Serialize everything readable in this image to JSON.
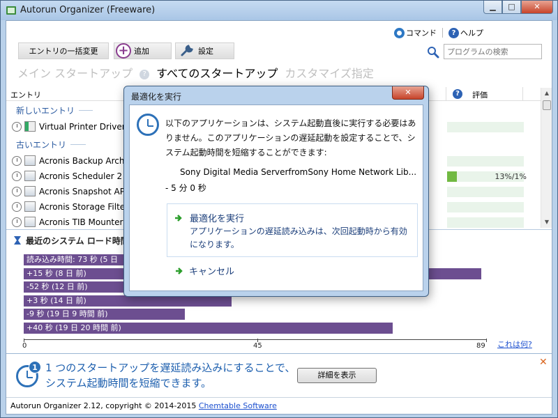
{
  "window": {
    "title": "Autorun Organizer (Freeware)",
    "minimize_glyph": "▁",
    "maximize_glyph": "□",
    "close_glyph": "✕"
  },
  "toolbar": {
    "command_label": "コマンド",
    "help_label": "ヘルプ",
    "bulk_edit_label": "エントリの一括変更",
    "add_label": "追加",
    "settings_label": "設定",
    "search_placeholder": "プログラムの検索"
  },
  "tabs": {
    "main": "メイン スタートアップ",
    "help_glyph": "?",
    "all": "すべてのスタートアップ",
    "custom": "カスタマイズ指定"
  },
  "list": {
    "header_entry": "エントリ",
    "header_question": "?",
    "header_rating": "評価",
    "group_new": "新しいエントリ",
    "group_old": "古いエントリ",
    "new_entries": [
      {
        "name": "Virtual Printer Driver cc",
        "percent": 0,
        "label": ""
      }
    ],
    "old_entries": [
      {
        "name": "Acronis Backup Archive",
        "percent": 0,
        "label": ""
      },
      {
        "name": "Acronis Scheduler 2",
        "percent": 13,
        "label": "13%/1%"
      },
      {
        "name": "Acronis Snapshot APIb",
        "percent": 0,
        "label": ""
      },
      {
        "name": "Acronis Storage Filter M",
        "percent": 0,
        "label": ""
      },
      {
        "name": "Acronis TIB Mounter D",
        "percent": 0,
        "label": ""
      }
    ]
  },
  "boot": {
    "title": "最近のシステム ロード時間",
    "axis_max": 89,
    "bars": [
      {
        "label": "読み込み時間: 73 秒 (5 日",
        "value": 73
      },
      {
        "label": "+15 秒 (8 日 前)",
        "value": 88
      },
      {
        "label": "-52 秒 (12 日 前)",
        "value": 21
      },
      {
        "label": "+3 秒 (14 日 前)",
        "value": 40
      },
      {
        "label": "-9 秒 (19 日 9 時間 前)",
        "value": 31
      },
      {
        "label": "+40 秒 (19 日 20 時間 前)",
        "value": 71
      }
    ],
    "ticks": [
      "0",
      "45",
      "89"
    ],
    "what_link": "これは何?"
  },
  "info": {
    "badge": "1",
    "line1": "1 つのスタートアップを遅延読み込みにすることで、",
    "line2": "システム起動時間を短縮できます。",
    "details_button": "詳細を表示",
    "dismiss_glyph": "✕"
  },
  "status": {
    "text": "Autorun Organizer 2.12, copyright © 2014-2015 ",
    "link": "Chemtable Software"
  },
  "dialog": {
    "title": "最適化を実行",
    "close_glyph": "✕",
    "message": "以下のアプリケーションは、システム起動直後に実行する必要はありません。このアプリケーションの遅延起動を設定することで、システム起動時間を短縮することができます:",
    "app_name": "Sony Digital Media ServerfromSony Home Network Lib...",
    "delay": "- 5 分 0 秒",
    "option_title": "最適化を実行",
    "option_desc": "アプリケーションの遅延読み込みは、次回起動時から有効になります。",
    "cancel": "キャンセル"
  },
  "colors": {
    "boot_bar": "#6c4e90",
    "rating_fill": "#71b942",
    "link": "#1b4fcf",
    "accent_blue": "#2d71b8"
  }
}
